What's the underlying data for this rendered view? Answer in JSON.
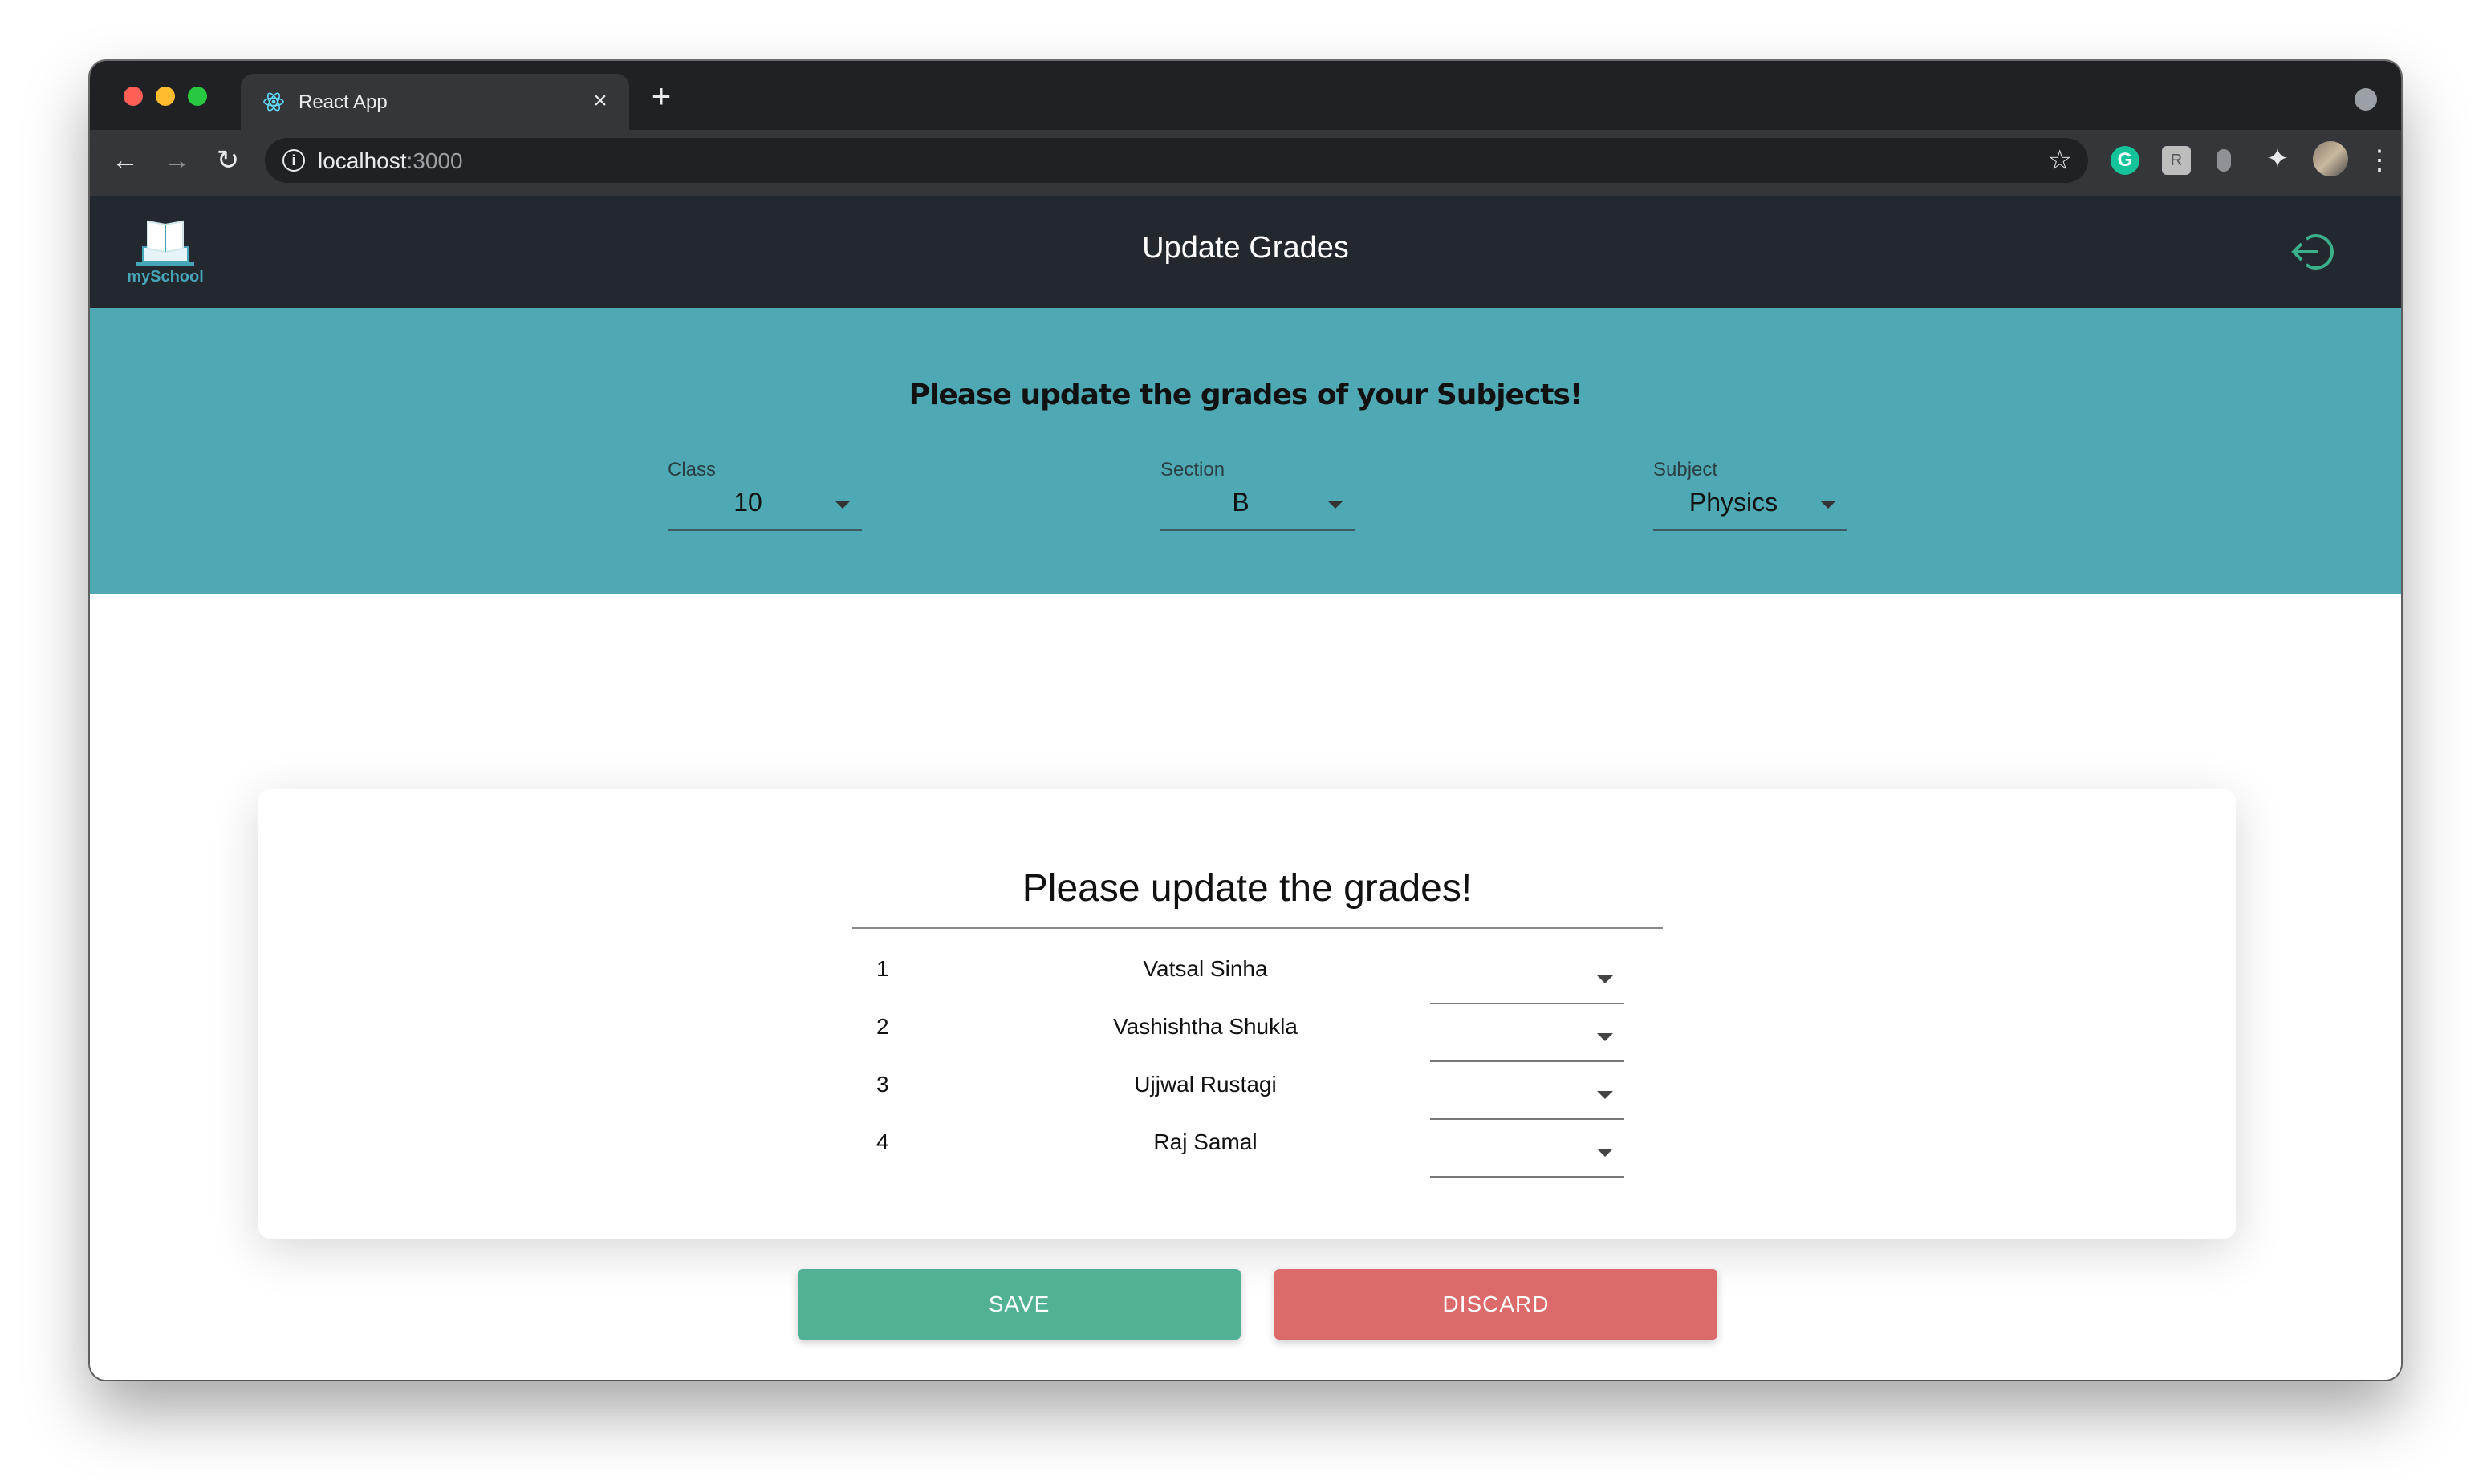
{
  "browser": {
    "tab_title": "React App",
    "tab_close": "×",
    "new_tab": "+",
    "url_host": "localhost",
    "url_port": ":3000",
    "extension_g": "G",
    "extension_r": "R"
  },
  "app": {
    "logo_text": "mySchool",
    "title": "Update Grades"
  },
  "banner": {
    "title": "Please update the grades of your Subjects!",
    "class_label": "Class",
    "class_value": "10",
    "section_label": "Section",
    "section_value": "B",
    "subject_label": "Subject",
    "subject_value": "Physics"
  },
  "grades_card": {
    "title": "Please update the grades!",
    "students": [
      {
        "num": "1",
        "name": "Vatsal Sinha",
        "grade": ""
      },
      {
        "num": "2",
        "name": "Vashishtha Shukla",
        "grade": ""
      },
      {
        "num": "3",
        "name": "Ujjwal Rustagi",
        "grade": ""
      },
      {
        "num": "4",
        "name": "Raj Samal",
        "grade": ""
      }
    ]
  },
  "actions": {
    "save_label": "SAVE",
    "discard_label": "DISCARD"
  },
  "colors": {
    "appbar": "#23272e",
    "banner": "#4fa9b4",
    "save": "#52b094",
    "discard": "#dc6a6a",
    "logout_icon": "#3ab08a"
  },
  "icons": {
    "tab_favicon": "react-icon",
    "logout": "logout-icon",
    "logo": "book-laptop-icon"
  }
}
